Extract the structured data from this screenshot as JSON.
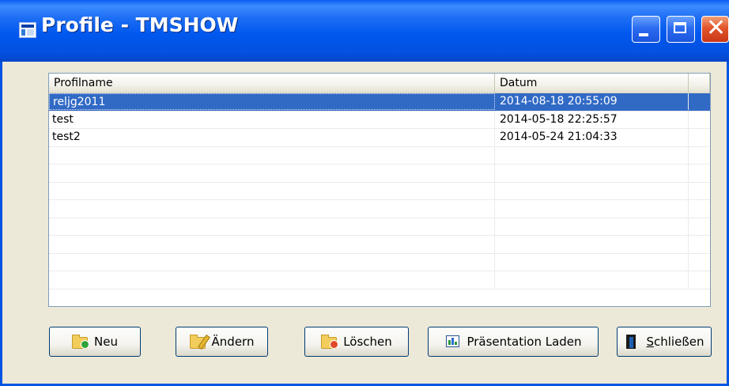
{
  "window": {
    "title": "Profile - TMSHOW",
    "icon": "app-window-icon",
    "controls": [
      "minimize",
      "maximize",
      "close"
    ]
  },
  "table": {
    "columns": [
      "Profilname",
      "Datum"
    ],
    "rows": [
      {
        "name": "reljg2011",
        "date": "2014-08-18 20:55:09",
        "selected": true
      },
      {
        "name": "test",
        "date": "2014-05-18 22:25:57",
        "selected": false
      },
      {
        "name": "test2",
        "date": "2014-05-24 21:04:33",
        "selected": false
      }
    ],
    "empty_rows": 8
  },
  "buttons": {
    "new": {
      "label": "Neu",
      "icon": "folder-new-icon"
    },
    "edit": {
      "label": "Ändern",
      "icon": "folder-edit-icon"
    },
    "delete": {
      "label": "Löschen",
      "icon": "folder-delete-icon"
    },
    "load": {
      "label": "Präsentation Laden",
      "icon": "presentation-icon"
    },
    "close": {
      "label": "Schließen",
      "accel_char": "S",
      "rest": "chließen",
      "icon": "exit-door-icon"
    }
  },
  "colors": {
    "titlebar": "#0058ee",
    "selection": "#316ac5",
    "client": "#ece9d8"
  }
}
